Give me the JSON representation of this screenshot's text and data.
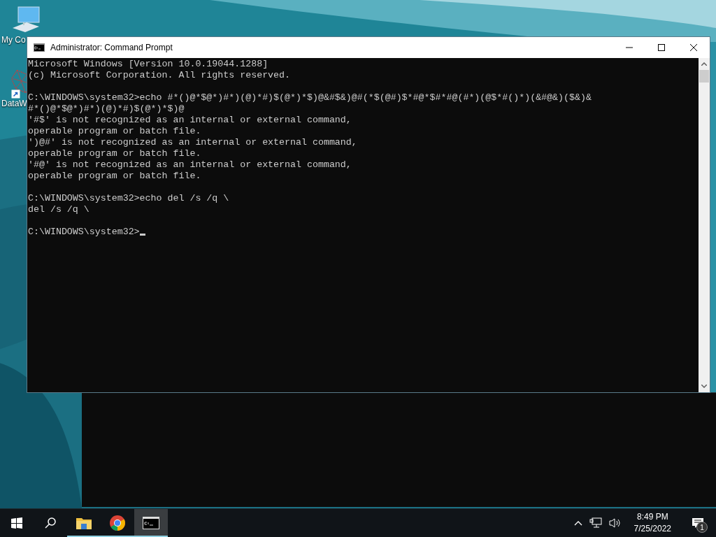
{
  "desktop": {
    "icons": [
      {
        "label": "My Co",
        "kind": "computer"
      },
      {
        "label": "DataW",
        "kind": "shortcut"
      }
    ]
  },
  "window": {
    "title": "Administrator: Command Prompt",
    "blocks": [
      [
        "Microsoft Windows [Version 10.0.19044.1288]",
        "(c) Microsoft Corporation. All rights reserved."
      ],
      [
        "C:\\WINDOWS\\system32>echo #*()@*$@*)#*)(@)*#)$(@*)*$)@&#$&)@#(*$(@#)$*#@*$#*#@(#*)(@$*#()*)(&#@&)($&)&",
        "#*()@*$@*)#*)(@)*#)$(@*)*$)@",
        "'#$' is not recognized as an internal or external command,",
        "operable program or batch file.",
        "')@#' is not recognized as an internal or external command,",
        "operable program or batch file.",
        "'#@' is not recognized as an internal or external command,",
        "operable program or batch file."
      ],
      [
        "C:\\WINDOWS\\system32>echo del /s /q \\",
        "del /s /q \\"
      ]
    ],
    "prompt": "C:\\WINDOWS\\system32>",
    "cursor": true
  },
  "taskbar": {
    "items": [
      {
        "kind": "start",
        "running": false,
        "selected": false
      },
      {
        "kind": "search",
        "running": false,
        "selected": false
      },
      {
        "kind": "explorer",
        "running": true,
        "selected": false
      },
      {
        "kind": "chrome",
        "running": true,
        "selected": false
      },
      {
        "kind": "terminal",
        "running": true,
        "selected": true
      }
    ],
    "time": "8:49 PM",
    "date": "7/25/2022",
    "notifications": "1"
  }
}
